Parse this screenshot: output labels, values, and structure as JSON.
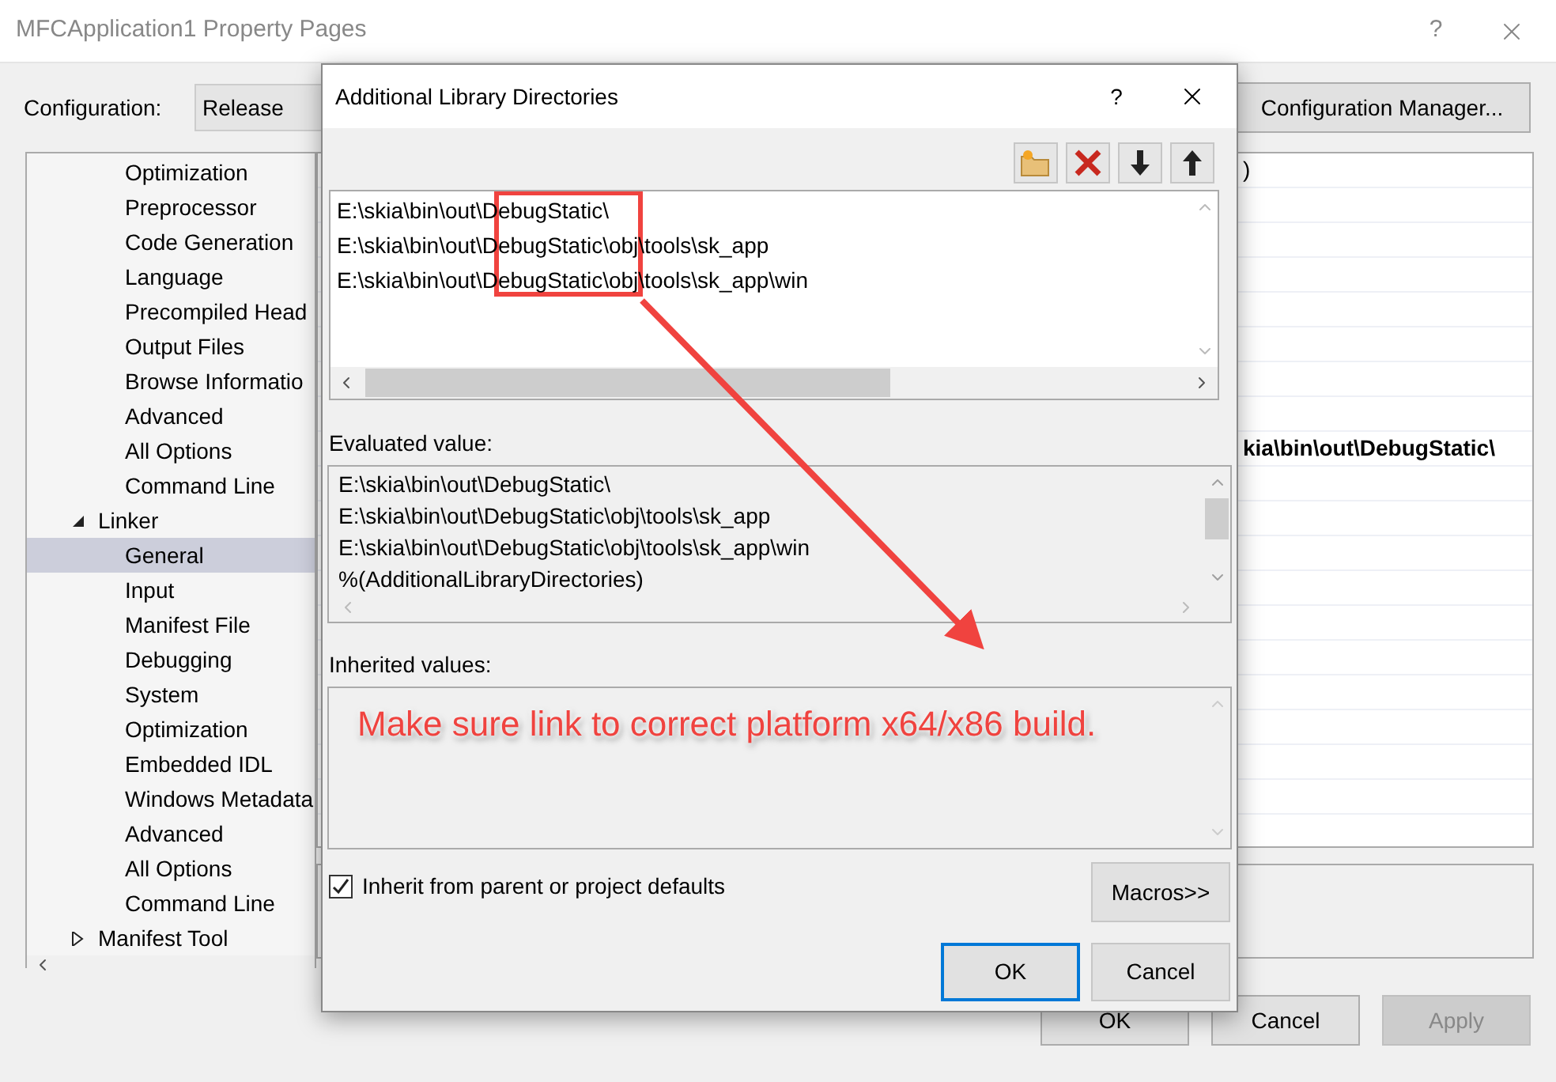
{
  "window": {
    "title": "MFCApplication1 Property Pages",
    "help": "?"
  },
  "configuration": {
    "label": "Configuration:",
    "value": "Release"
  },
  "config_manager_button": "Configuration Manager...",
  "tree": {
    "partial_items": [
      {
        "label": "Optimization"
      },
      {
        "label": "Preprocessor"
      },
      {
        "label": "Code Generation"
      },
      {
        "label": "Language"
      },
      {
        "label": "Precompiled Head"
      },
      {
        "label": "Output Files"
      },
      {
        "label": "Browse Informatio"
      },
      {
        "label": "Advanced"
      },
      {
        "label": "All Options"
      },
      {
        "label": "Command Line"
      }
    ],
    "nodes": [
      {
        "label": "Linker",
        "expanded": true,
        "children": [
          {
            "label": "General",
            "selected": true
          },
          {
            "label": "Input",
            "selected": false
          },
          {
            "label": "Manifest File",
            "selected": false
          },
          {
            "label": "Debugging",
            "selected": false
          },
          {
            "label": "System",
            "selected": false
          },
          {
            "label": "Optimization",
            "selected": false
          },
          {
            "label": "Embedded IDL",
            "selected": false
          },
          {
            "label": "Windows Metadata",
            "selected": false
          },
          {
            "label": "Advanced",
            "selected": false
          },
          {
            "label": "All Options",
            "selected": false
          },
          {
            "label": "Command Line",
            "selected": false
          }
        ]
      },
      {
        "label": "Manifest Tool",
        "expanded": false
      }
    ]
  },
  "property_grid": {
    "rows": [
      {
        "value": ")",
        "bold": false
      },
      {
        "value": "kia\\bin\\out\\DebugStatic\\",
        "bold": true
      }
    ]
  },
  "buttons": [
    {
      "label": "OK",
      "disabled": false
    },
    {
      "label": "Cancel",
      "disabled": false
    },
    {
      "label": "Apply",
      "disabled": true
    }
  ],
  "dialog": {
    "title": "Additional Library Directories",
    "help": "?",
    "toolbar": [
      {
        "kind": "new-folder"
      },
      {
        "kind": "delete"
      },
      {
        "kind": "move-down"
      },
      {
        "kind": "move-up"
      }
    ],
    "directories": [
      "E:\\skia\\bin\\out\\DebugStatic\\",
      "E:\\skia\\bin\\out\\DebugStatic\\obj\\tools\\sk_app",
      "E:\\skia\\bin\\out\\DebugStatic\\obj\\tools\\sk_app\\win"
    ],
    "evaluated_label": "Evaluated value:",
    "evaluated": [
      "E:\\skia\\bin\\out\\DebugStatic\\",
      "E:\\skia\\bin\\out\\DebugStatic\\obj\\tools\\sk_app",
      "E:\\skia\\bin\\out\\DebugStatic\\obj\\tools\\sk_app\\win",
      "%(AdditionalLibraryDirectories)"
    ],
    "inherited_label": "Inherited values:",
    "inherit_checkbox": {
      "label": "Inherit from parent or project defaults",
      "checked": true
    },
    "macros_button": "Macros>>",
    "buttons": [
      {
        "label": "OK",
        "focused": true
      },
      {
        "label": "Cancel",
        "focused": false
      }
    ]
  },
  "annotation": {
    "text": "Make sure link to correct platform x64/x86 build."
  }
}
